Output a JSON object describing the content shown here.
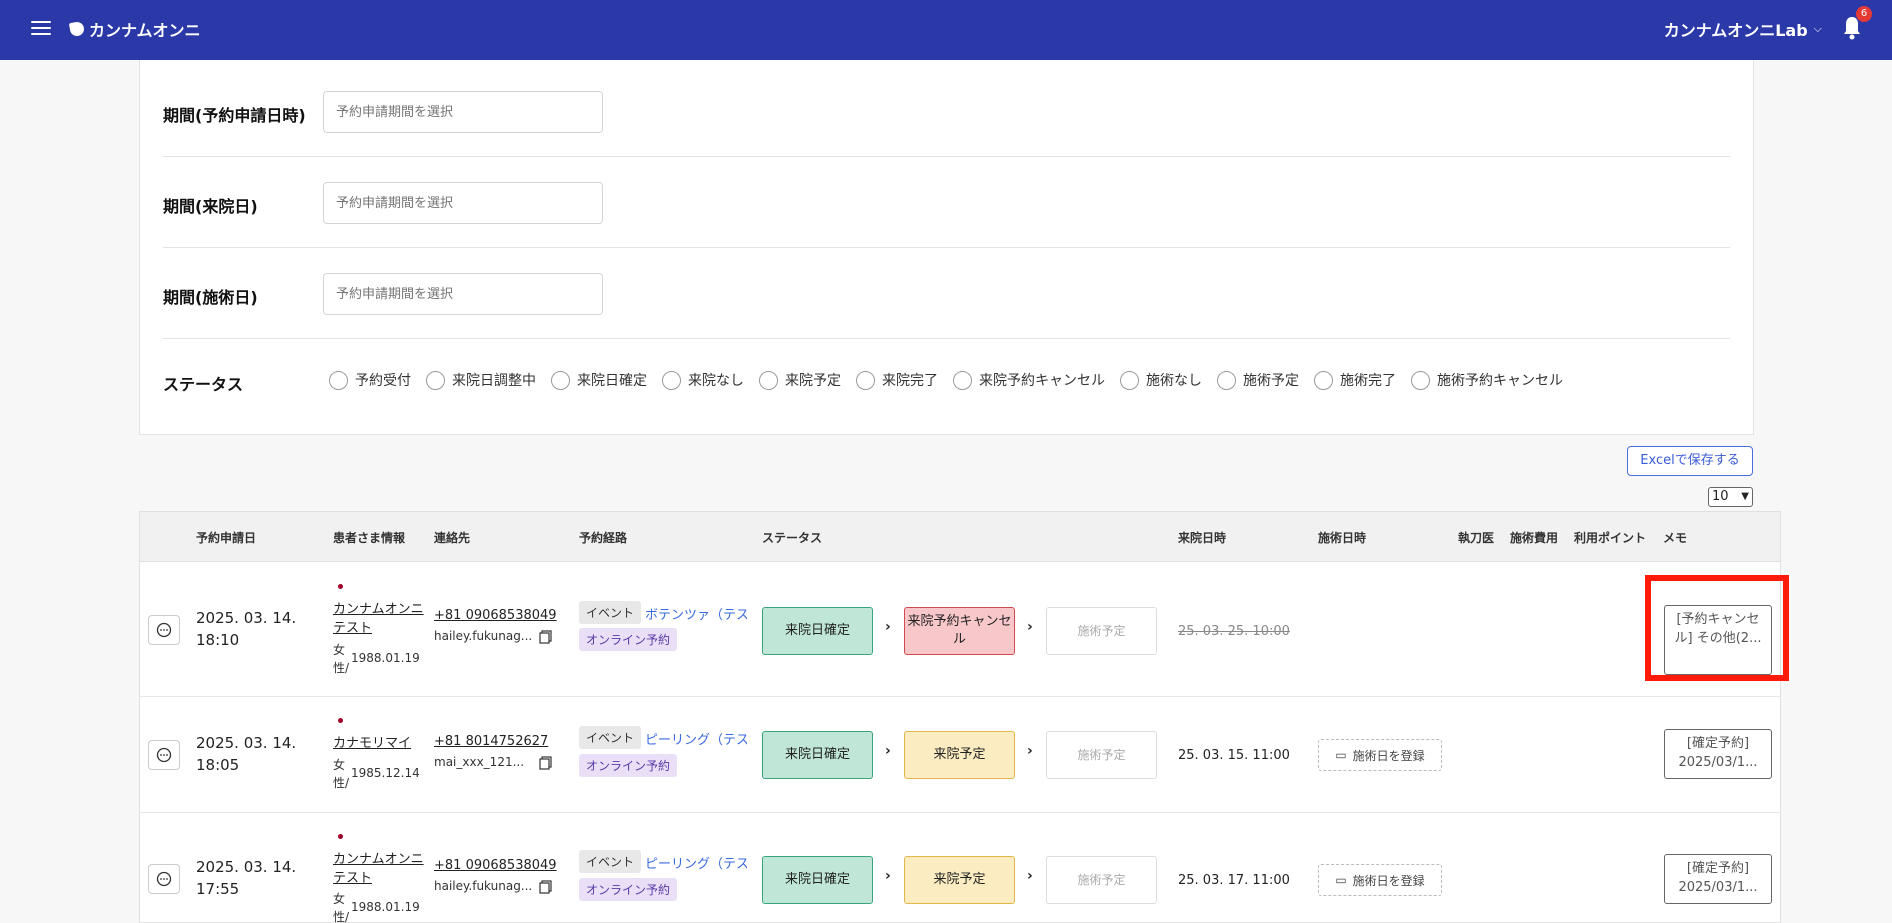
{
  "header": {
    "logo_text": "カンナムオンニ",
    "account_name": "カンナムオンニLab",
    "notification_count": "6"
  },
  "filters": {
    "rows": [
      {
        "label": "期間(予約申請日時)",
        "placeholder": "予約申請期間を選択"
      },
      {
        "label": "期間(来院日)",
        "placeholder": "予約申請期間を選択"
      },
      {
        "label": "期間(施術日)",
        "placeholder": "予約申請期間を選択"
      }
    ],
    "status_label": "ステータス",
    "status_options": [
      "予約受付",
      "来院日調整中",
      "来院日確定",
      "来院なし",
      "来院予定",
      "来院完了",
      "来院予約キャンセル",
      "施術なし",
      "施術予定",
      "施術完了",
      "施術予約キャンセル"
    ]
  },
  "actions": {
    "excel_label": "Excelで保存する",
    "page_size": "10"
  },
  "table": {
    "columns": [
      "予約申請日",
      "患者さま情報",
      "連絡先",
      "予約経路",
      "ステータス",
      "来院日時",
      "施術日時",
      "執刀医",
      "施術費用",
      "利用ポイント",
      "メモ"
    ],
    "rows": [
      {
        "date_line1": "2025. 03. 14.",
        "date_line2": "18:10",
        "patient_name": "カンナムオンニテスト",
        "sex": "女性/",
        "birth": "1988.01.19",
        "phone": "+81 09068538049",
        "email": "hailey.fukunag...",
        "tag_event": "イベント",
        "route_link": "ボテンツァ（テスト",
        "tag_online": "オンライン予約",
        "status1": "来院日確定",
        "status2": "来院予約キャンセル",
        "status3": "施術予定",
        "visit_datetime": "25. 03. 25. 10:00",
        "treat_btn": "",
        "memo": "[予約キャンセル] その他(2..."
      },
      {
        "date_line1": "2025. 03. 14.",
        "date_line2": "18:05",
        "patient_name": "カナモリマイ",
        "sex": "女性/",
        "birth": "1985.12.14",
        "phone": "+81 8014752627",
        "email": "mai_xxx_121...",
        "tag_event": "イベント",
        "route_link": "ピーリング（テスト",
        "tag_online": "オンライン予約",
        "status1": "来院日確定",
        "status2": "来院予定",
        "status3": "施術予定",
        "visit_datetime": "25. 03. 15. 11:00",
        "treat_btn": "施術日を登録",
        "memo": "[確定予約] 2025/03/1..."
      },
      {
        "date_line1": "2025. 03. 14.",
        "date_line2": "17:55",
        "patient_name": "カンナムオンニテスト",
        "sex": "女性/",
        "birth": "1988.01.19",
        "phone": "+81 09068538049",
        "email": "hailey.fukunag...",
        "tag_event": "イベント",
        "route_link": "ピーリング（テスト",
        "tag_online": "オンライン予約",
        "status1": "来院日確定",
        "status2": "来院予定",
        "status3": "施術予定",
        "visit_datetime": "25. 03. 17. 11:00",
        "treat_btn": "施術日を登録",
        "memo": "[確定予約] 2025/03/1..."
      }
    ]
  },
  "colors": {
    "topbar": "#2b38a8",
    "highlight": "#ff1a0a",
    "status_green": "#bfe6d6",
    "status_red": "#f7c7c9",
    "status_yellow": "#fbecc2"
  }
}
